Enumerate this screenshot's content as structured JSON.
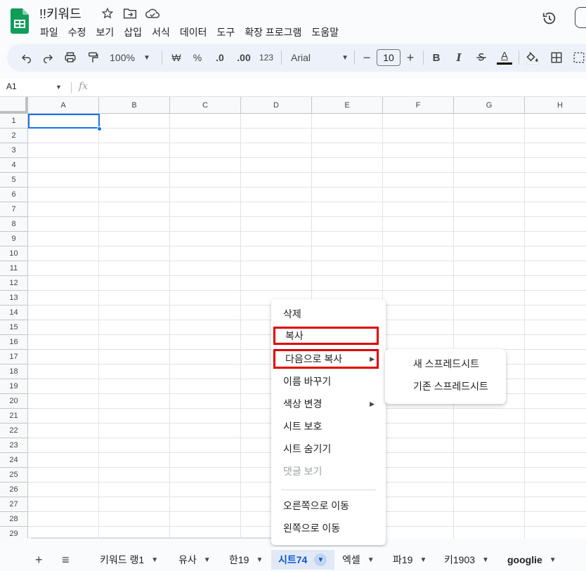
{
  "header": {
    "title": "!!키워드",
    "menu": [
      "파일",
      "수정",
      "보기",
      "삽입",
      "서식",
      "데이터",
      "도구",
      "확장 프로그램",
      "도움말"
    ]
  },
  "toolbar": {
    "zoom": "100%",
    "currency": "₩",
    "percent": "%",
    "dec_decrease": ".0",
    "dec_increase": ".00",
    "format_123": "123",
    "font": "Arial",
    "font_size": "10",
    "bold": "B",
    "italic": "I",
    "text_color": "A"
  },
  "formula_bar": {
    "cell_ref": "A1",
    "fx": "fx"
  },
  "grid": {
    "columns": [
      "A",
      "B",
      "C",
      "D",
      "E",
      "F",
      "G",
      "H"
    ],
    "rows": [
      "1",
      "2",
      "3",
      "4",
      "5",
      "6",
      "7",
      "8",
      "9",
      "10",
      "11",
      "12",
      "13",
      "14",
      "15",
      "16",
      "17",
      "18",
      "19",
      "20",
      "21",
      "22",
      "23",
      "24",
      "25",
      "26",
      "27",
      "28",
      "29"
    ]
  },
  "context_menu": {
    "items": [
      "삭제",
      "복사",
      "다음으로 복사",
      "이름 바꾸기",
      "색상 변경",
      "시트 보호",
      "시트 숨기기",
      "댓글 보기",
      "오른쪽으로 이동",
      "왼쪽으로 이동"
    ],
    "submenu": [
      "새 스프레드시트",
      "기존 스프레드시트"
    ]
  },
  "sheet_tabs": [
    "키워드 랭1",
    "유사",
    "한19",
    "시트74",
    "엑셀",
    "파19",
    "키1903",
    "googlie"
  ],
  "colors": {
    "accent": "#1a73e8",
    "highlight_box": "#e00000",
    "active_tab": "#0b57d0",
    "logo_green": "#0f9d58"
  }
}
